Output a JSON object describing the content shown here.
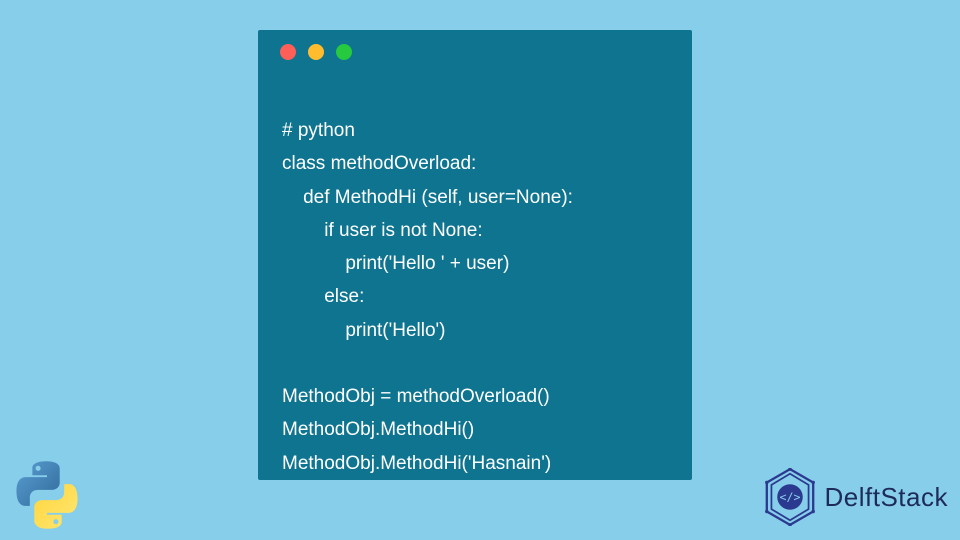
{
  "window": {
    "dots": {
      "red": "#ff5f56",
      "yellow": "#ffbd2e",
      "green": "#27c93f"
    }
  },
  "code": {
    "lines": [
      "# python",
      "class methodOverload:",
      "    def MethodHi (self, user=None):",
      "        if user is not None:",
      "            print('Hello ' + user)",
      "        else:",
      "            print('Hello')",
      "",
      "MethodObj = methodOverload()",
      "MethodObj.MethodHi()",
      "MethodObj.MethodHi('Hasnain')"
    ]
  },
  "brand": {
    "name": "DelftStack"
  },
  "colors": {
    "background": "#87ceeb",
    "window": "#0e7490",
    "text": "#ffffff",
    "brand": "#1e2a5a"
  }
}
